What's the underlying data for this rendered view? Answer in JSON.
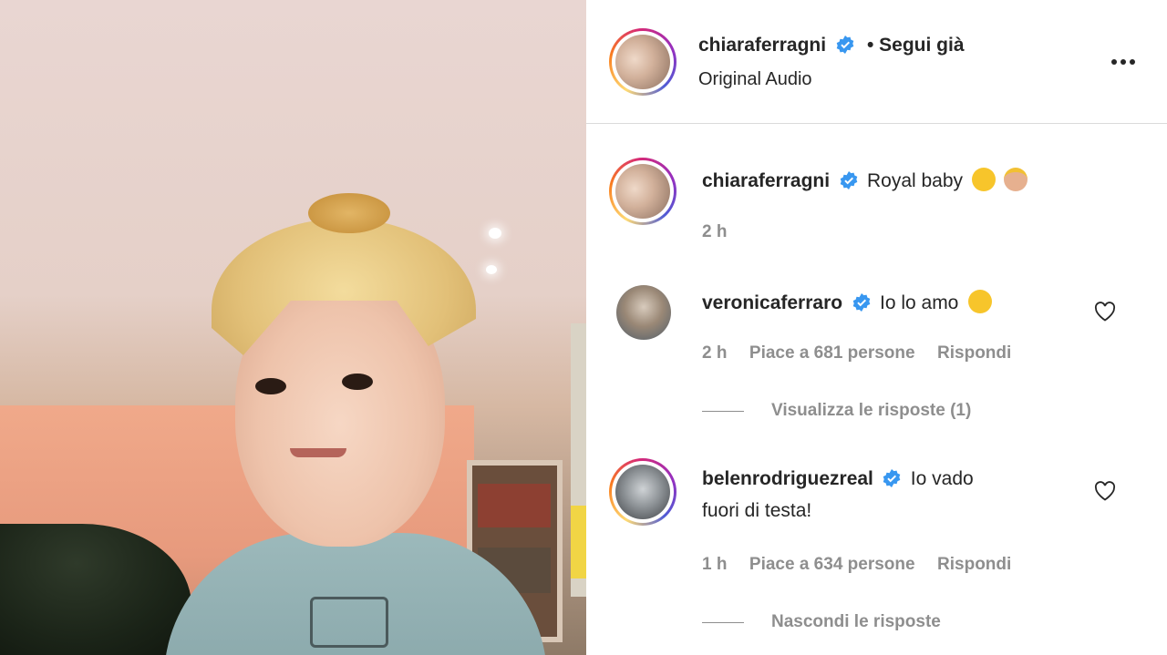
{
  "header": {
    "username": "chiaraferragni",
    "follow_status": "• Segui già",
    "audio": "Original Audio"
  },
  "caption": {
    "username": "chiaraferragni",
    "text": "Royal baby",
    "time": "2 h"
  },
  "comments": [
    {
      "username": "veronicaferraro",
      "text": "Io lo amo",
      "time": "2 h",
      "likes": "Piace a 681 persone",
      "reply": "Rispondi",
      "replies_toggle": "Visualizza le risposte (1)"
    },
    {
      "username": "belenrodriguezreal",
      "text_line1": "Io vado",
      "text_line2": "fuori di testa!",
      "time": "1 h",
      "likes": "Piace a 634 persone",
      "reply": "Rispondi",
      "replies_toggle": "Nascondi le risposte"
    }
  ],
  "icons": {
    "verified": "verified-badge-icon",
    "more": "more-options-icon",
    "like": "heart-icon",
    "emoji_laugh": "tears-of-joy-emoji",
    "emoji_prince": "prince-emoji"
  },
  "colors": {
    "verified_blue": "#3897f0",
    "text": "#262626",
    "muted": "#8e8e8e"
  }
}
